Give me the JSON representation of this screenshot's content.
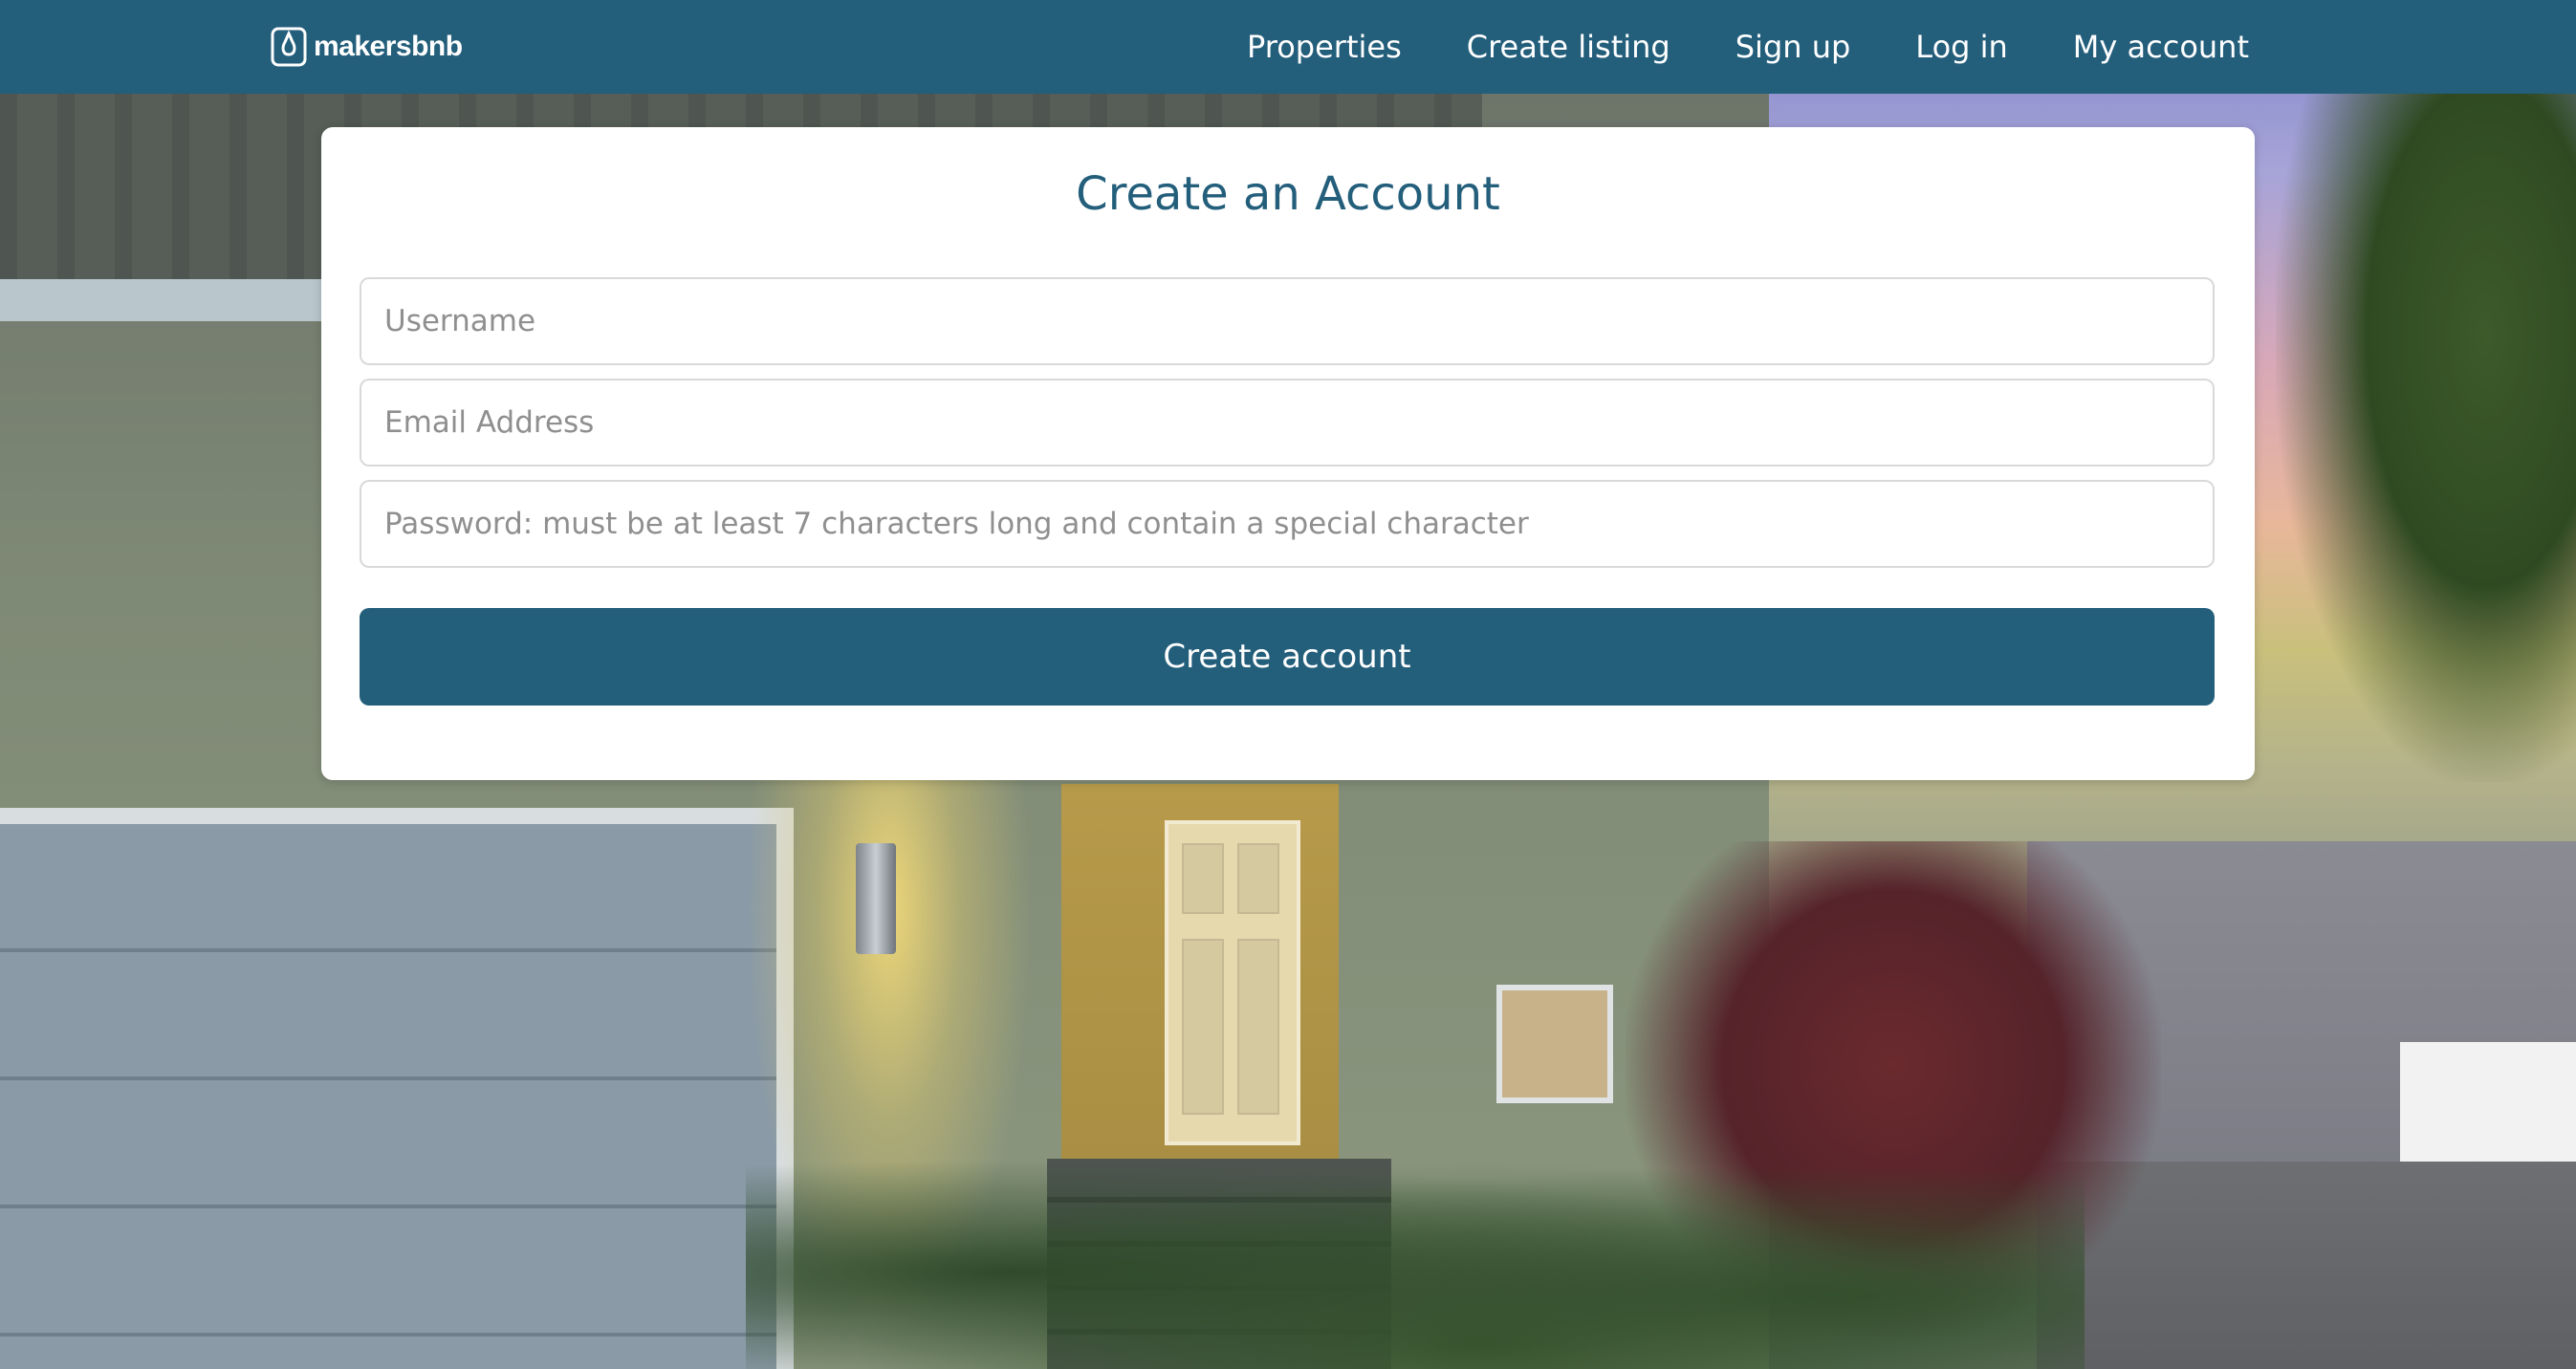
{
  "brand": {
    "name": "makersbnb",
    "icon": "bnb-logo-icon"
  },
  "nav": {
    "items": [
      {
        "label": "Properties"
      },
      {
        "label": "Create listing"
      },
      {
        "label": "Sign up"
      },
      {
        "label": "Log in"
      },
      {
        "label": "My account"
      }
    ]
  },
  "form": {
    "title": "Create an Account",
    "username": {
      "value": "",
      "placeholder": "Username"
    },
    "email": {
      "value": "",
      "placeholder": "Email Address"
    },
    "password": {
      "value": "",
      "placeholder": "Password: must be at least 7 characters long and contain a special character"
    },
    "submit_label": "Create account"
  },
  "colors": {
    "primary": "#235e7b",
    "card_bg": "#ffffff",
    "input_border": "#d9d9d9",
    "placeholder": "#8f8f8f"
  }
}
